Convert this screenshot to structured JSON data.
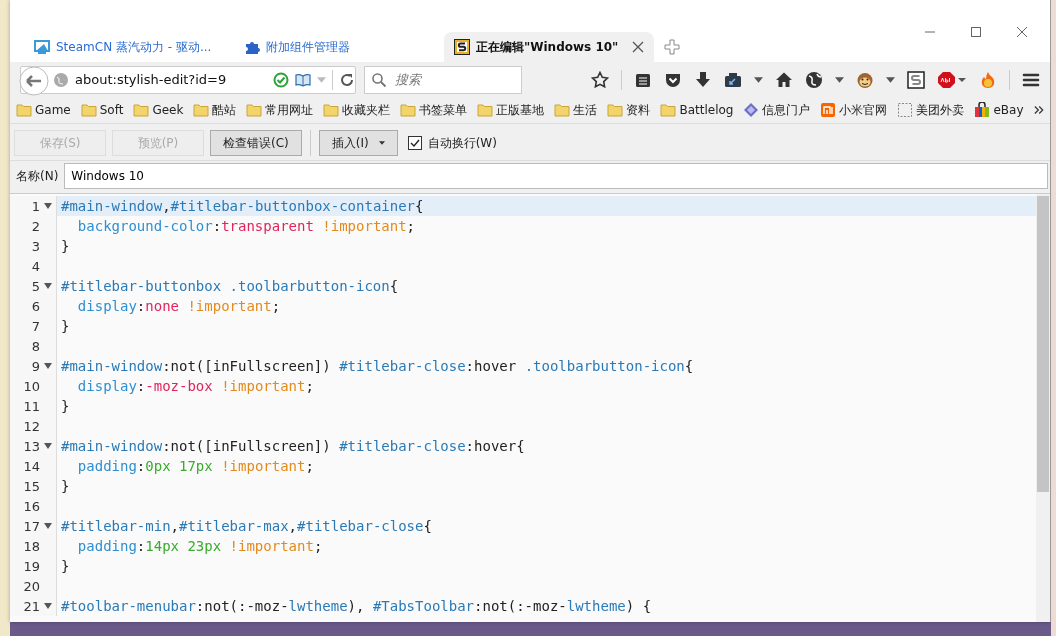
{
  "tabs": [
    {
      "title": "SteamCN 蒸汽动力 - 驱动...",
      "selected": false
    },
    {
      "title": "附加组件管理器",
      "selected": false
    },
    {
      "title": "正在编辑\"Windows 10\"",
      "selected": true
    }
  ],
  "address": {
    "value": "about:stylish-edit?id=9"
  },
  "search": {
    "placeholder": "搜索"
  },
  "bookmarks": [
    {
      "label": "Game",
      "kind": "folder"
    },
    {
      "label": "Soft",
      "kind": "folder"
    },
    {
      "label": "Geek",
      "kind": "folder"
    },
    {
      "label": "酷站",
      "kind": "folder"
    },
    {
      "label": "常用网址",
      "kind": "folder"
    },
    {
      "label": "收藏夹栏",
      "kind": "folder"
    },
    {
      "label": "书签菜单",
      "kind": "folder"
    },
    {
      "label": "正版基地",
      "kind": "folder"
    },
    {
      "label": "生活",
      "kind": "folder"
    },
    {
      "label": "资料",
      "kind": "folder"
    },
    {
      "label": "Battlelog",
      "kind": "folder"
    },
    {
      "label": "信息门户",
      "kind": "diamond"
    },
    {
      "label": "小米官网",
      "kind": "mi"
    },
    {
      "label": "美团外卖",
      "kind": "blank"
    },
    {
      "label": "eBay",
      "kind": "bag"
    }
  ],
  "editor_toolbar": {
    "buttons": [
      {
        "label": "保存(S)",
        "disabled": true
      },
      {
        "label": "预览(P)",
        "disabled": true
      },
      {
        "label": "检查错误(C)",
        "disabled": false
      }
    ],
    "insert_menu": {
      "label": "插入(I)"
    },
    "word_wrap": {
      "label": "自动换行(W)",
      "checked": true
    }
  },
  "name_field": {
    "label": "名称(N)",
    "value": "Windows 10"
  },
  "code_lines": [
    {
      "num": "1",
      "foldable": true,
      "current": true,
      "tokens": [
        {
          "t": "#main-window",
          "kind": "sel"
        },
        {
          "t": ",",
          "kind": "text"
        },
        {
          "t": "#titlebar-buttonbox-container",
          "kind": "sel"
        },
        {
          "t": "{",
          "kind": "text"
        }
      ]
    },
    {
      "num": "2",
      "foldable": false,
      "current": false,
      "tokens": [
        {
          "t": "  background-color",
          "kind": "prop"
        },
        {
          "t": ":",
          "kind": "text"
        },
        {
          "t": "transparent",
          "kind": "kw"
        },
        {
          "t": " !important",
          "kind": "imp"
        },
        {
          "t": ";",
          "kind": "text"
        }
      ]
    },
    {
      "num": "3",
      "foldable": false,
      "current": false,
      "tokens": [
        {
          "t": "}",
          "kind": "text"
        }
      ]
    },
    {
      "num": "4",
      "foldable": false,
      "current": false
    },
    {
      "num": "5",
      "foldable": true,
      "current": false,
      "tokens": [
        {
          "t": "#titlebar-buttonbox",
          "kind": "sel"
        },
        {
          "t": " .toolbarbutton-icon",
          "kind": "sel"
        },
        {
          "t": "{",
          "kind": "text"
        }
      ]
    },
    {
      "num": "6",
      "foldable": false,
      "current": false,
      "tokens": [
        {
          "t": "  display",
          "kind": "prop"
        },
        {
          "t": ":",
          "kind": "text"
        },
        {
          "t": "none",
          "kind": "kw"
        },
        {
          "t": " !important",
          "kind": "imp"
        },
        {
          "t": ";",
          "kind": "text"
        }
      ]
    },
    {
      "num": "7",
      "foldable": false,
      "current": false,
      "tokens": [
        {
          "t": "}",
          "kind": "text"
        }
      ]
    },
    {
      "num": "8",
      "foldable": false,
      "current": false
    },
    {
      "num": "9",
      "foldable": true,
      "current": false,
      "tokens": [
        {
          "t": "#main-window",
          "kind": "sel"
        },
        {
          "t": ":not([inFullscreen]) ",
          "kind": "text"
        },
        {
          "t": "#titlebar-close",
          "kind": "sel"
        },
        {
          "t": ":hover ",
          "kind": "text"
        },
        {
          "t": ".toolbarbutton-icon",
          "kind": "sel"
        },
        {
          "t": "{",
          "kind": "text"
        }
      ]
    },
    {
      "num": "10",
      "foldable": false,
      "current": false,
      "tokens": [
        {
          "t": "  display",
          "kind": "prop"
        },
        {
          "t": ":",
          "kind": "text"
        },
        {
          "t": "-moz-box",
          "kind": "kw"
        },
        {
          "t": " !important",
          "kind": "imp"
        },
        {
          "t": ";",
          "kind": "text"
        }
      ]
    },
    {
      "num": "11",
      "foldable": false,
      "current": false,
      "tokens": [
        {
          "t": "}",
          "kind": "text"
        }
      ]
    },
    {
      "num": "12",
      "foldable": false,
      "current": false
    },
    {
      "num": "13",
      "foldable": true,
      "current": false,
      "tokens": [
        {
          "t": "#main-window",
          "kind": "sel"
        },
        {
          "t": ":not([inFullscreen]) ",
          "kind": "text"
        },
        {
          "t": "#titlebar-close",
          "kind": "sel"
        },
        {
          "t": ":hover{",
          "kind": "text"
        }
      ]
    },
    {
      "num": "14",
      "foldable": false,
      "current": false,
      "tokens": [
        {
          "t": "  padding",
          "kind": "prop"
        },
        {
          "t": ":",
          "kind": "text"
        },
        {
          "t": "0px 17px",
          "kind": "num"
        },
        {
          "t": " !important",
          "kind": "imp"
        },
        {
          "t": ";",
          "kind": "text"
        }
      ]
    },
    {
      "num": "15",
      "foldable": false,
      "current": false,
      "tokens": [
        {
          "t": "}",
          "kind": "text"
        }
      ]
    },
    {
      "num": "16",
      "foldable": false,
      "current": false
    },
    {
      "num": "17",
      "foldable": true,
      "current": false,
      "tokens": [
        {
          "t": "#titlebar-min",
          "kind": "sel"
        },
        {
          "t": ",",
          "kind": "text"
        },
        {
          "t": "#titlebar-max",
          "kind": "sel"
        },
        {
          "t": ",",
          "kind": "text"
        },
        {
          "t": "#titlebar-close",
          "kind": "sel"
        },
        {
          "t": "{",
          "kind": "text"
        }
      ]
    },
    {
      "num": "18",
      "foldable": false,
      "current": false,
      "tokens": [
        {
          "t": "  padding",
          "kind": "prop"
        },
        {
          "t": ":",
          "kind": "text"
        },
        {
          "t": "14px 23px",
          "kind": "num"
        },
        {
          "t": " !important",
          "kind": "imp"
        },
        {
          "t": ";",
          "kind": "text"
        }
      ]
    },
    {
      "num": "19",
      "foldable": false,
      "current": false,
      "tokens": [
        {
          "t": "}",
          "kind": "text"
        }
      ]
    },
    {
      "num": "20",
      "foldable": false,
      "current": false
    },
    {
      "num": "21",
      "foldable": true,
      "current": false,
      "tokens": [
        {
          "t": "#toolbar-menubar",
          "kind": "sel"
        },
        {
          "t": ":not(:-moz-",
          "kind": "text"
        },
        {
          "t": "lwtheme",
          "kind": "sel"
        },
        {
          "t": "), ",
          "kind": "text"
        },
        {
          "t": "#TabsToolbar",
          "kind": "sel"
        },
        {
          "t": ":not(:-moz-",
          "kind": "text"
        },
        {
          "t": "lwtheme",
          "kind": "sel"
        },
        {
          "t": ") {",
          "kind": "text"
        }
      ]
    }
  ]
}
